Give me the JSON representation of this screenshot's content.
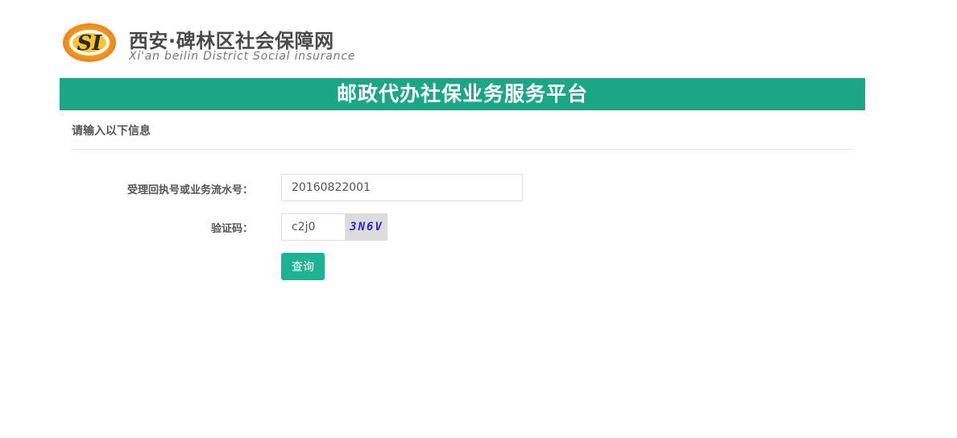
{
  "header": {
    "site_title": "西安·碑林区社会保障网",
    "site_subtitle": "Xi'an beilin District Social insurance",
    "logo_icon": "si-logo-icon"
  },
  "banner": {
    "title": "邮政代办社保业务服务平台"
  },
  "form": {
    "section_title": "请输入以下信息",
    "serial_label": "受理回执号或业务流水号：",
    "serial_value": "20160822001",
    "captcha_label": "验证码：",
    "captcha_value": "c2j0",
    "captcha_image_text": "3N6V",
    "query_label": "查询"
  },
  "colors": {
    "banner_bg": "#1ba686",
    "button_bg": "#1cb393",
    "logo_orange": "#f08a1c",
    "captcha_text": "#2828d0"
  }
}
